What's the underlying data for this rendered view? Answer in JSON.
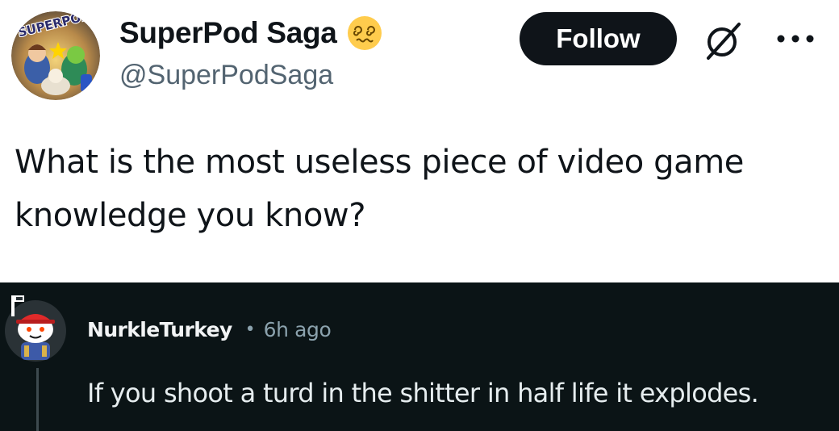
{
  "tweet": {
    "avatar_text": "SUPERPOD SAGA",
    "display_name": "SuperPod Saga",
    "badge_icon": "dizzy-face-emoji",
    "handle": "@SuperPodSaga",
    "follow_label": "Follow",
    "grok_icon": "slashed-circle-icon",
    "more_icon": "ellipsis-icon",
    "text": "What is the most useless piece of video game knowledge you know?"
  },
  "comment": {
    "avatar_icon": "snoo-avatar",
    "username": "NurkleTurkey",
    "separator": "•",
    "timestamp": "6h ago",
    "text": "If you shoot a turd in the shitter in half life it explodes."
  },
  "colors": {
    "tweet_bg": "#ffffff",
    "follow_bg": "#0f1419",
    "handle": "#536471",
    "comment_bg": "#0b1416",
    "comment_text": "#e6edef",
    "comment_meta": "#8ba2ad"
  }
}
